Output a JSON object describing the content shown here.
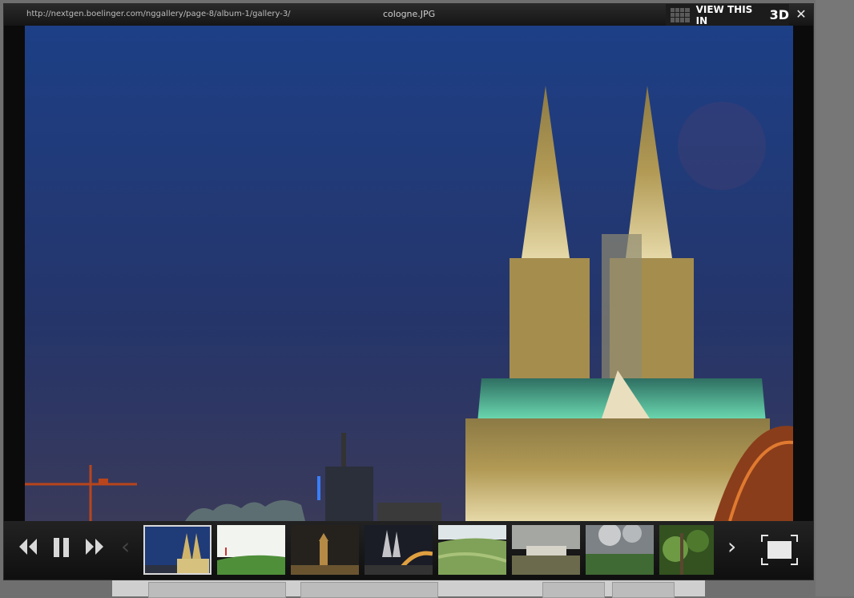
{
  "window": {
    "url": "http://nextgen.boelinger.com/nggallery/page-8/album-1/gallery-3/",
    "filename": "cologne.JPG",
    "view3d_label": "VIEW THIS IN",
    "view3d_suffix": "3D",
    "close_glyph": "✕"
  },
  "photo": {
    "subject": "Cologne Cathedral at dusk"
  },
  "controls": {
    "prev_thumbs_glyph": "‹",
    "next_thumbs_glyph": "›",
    "icons": [
      "rewind-icon",
      "pause-icon",
      "fast-forward-icon",
      "fullscreen-icon"
    ]
  },
  "thumbnails": [
    {
      "name": "cathedral-dusk",
      "active": true
    },
    {
      "name": "green-field"
    },
    {
      "name": "night-town"
    },
    {
      "name": "bridge-cathedral-night"
    },
    {
      "name": "green-hills"
    },
    {
      "name": "palace-gardens"
    },
    {
      "name": "cloudy-landscape"
    },
    {
      "name": "forest-plants"
    }
  ]
}
